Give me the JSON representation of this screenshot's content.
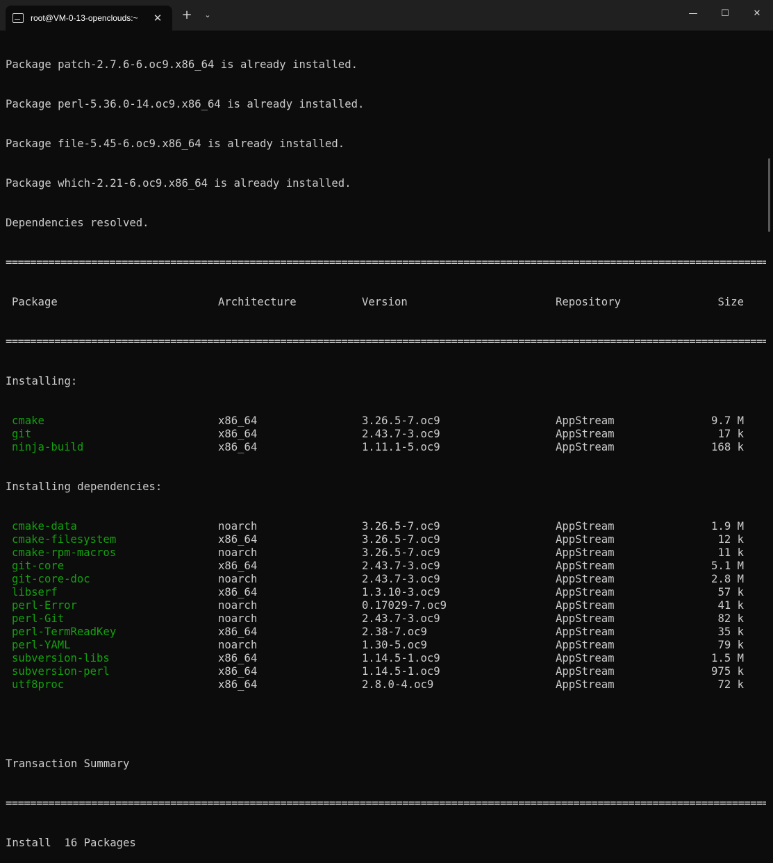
{
  "titlebar": {
    "tab_title": "root@VM-0-13-openclouds:~",
    "tab_close": "✕",
    "new_tab": "+",
    "dropdown": "⌄",
    "minimize": "—",
    "maximize": "☐",
    "close": "✕"
  },
  "output": {
    "pre_lines": [
      "Package patch-2.7.6-6.oc9.x86_64 is already installed.",
      "Package perl-5.36.0-14.oc9.x86_64 is already installed.",
      "Package file-5.45-6.oc9.x86_64 is already installed.",
      "Package which-2.21-6.oc9.x86_64 is already installed.",
      "Dependencies resolved."
    ],
    "rule": "================================================================================================================================",
    "header": {
      "package": "Package",
      "arch": "Architecture",
      "version": "Version",
      "repo": "Repository",
      "size": "Size"
    },
    "installing_label": "Installing:",
    "installing": [
      {
        "name": "cmake",
        "arch": "x86_64",
        "version": "3.26.5-7.oc9",
        "repo": "AppStream",
        "size": "9.7 M"
      },
      {
        "name": "git",
        "arch": "x86_64",
        "version": "2.43.7-3.oc9",
        "repo": "AppStream",
        "size": "17 k"
      },
      {
        "name": "ninja-build",
        "arch": "x86_64",
        "version": "1.11.1-5.oc9",
        "repo": "AppStream",
        "size": "168 k"
      }
    ],
    "deps_label": "Installing dependencies:",
    "deps": [
      {
        "name": "cmake-data",
        "arch": "noarch",
        "version": "3.26.5-7.oc9",
        "repo": "AppStream",
        "size": "1.9 M"
      },
      {
        "name": "cmake-filesystem",
        "arch": "x86_64",
        "version": "3.26.5-7.oc9",
        "repo": "AppStream",
        "size": "12 k"
      },
      {
        "name": "cmake-rpm-macros",
        "arch": "noarch",
        "version": "3.26.5-7.oc9",
        "repo": "AppStream",
        "size": "11 k"
      },
      {
        "name": "git-core",
        "arch": "x86_64",
        "version": "2.43.7-3.oc9",
        "repo": "AppStream",
        "size": "5.1 M"
      },
      {
        "name": "git-core-doc",
        "arch": "noarch",
        "version": "2.43.7-3.oc9",
        "repo": "AppStream",
        "size": "2.8 M"
      },
      {
        "name": "libserf",
        "arch": "x86_64",
        "version": "1.3.10-3.oc9",
        "repo": "AppStream",
        "size": "57 k"
      },
      {
        "name": "perl-Error",
        "arch": "noarch",
        "version": "0.17029-7.oc9",
        "repo": "AppStream",
        "size": "41 k"
      },
      {
        "name": "perl-Git",
        "arch": "noarch",
        "version": "2.43.7-3.oc9",
        "repo": "AppStream",
        "size": "82 k"
      },
      {
        "name": "perl-TermReadKey",
        "arch": "x86_64",
        "version": "2.38-7.oc9",
        "repo": "AppStream",
        "size": "35 k"
      },
      {
        "name": "perl-YAML",
        "arch": "noarch",
        "version": "1.30-5.oc9",
        "repo": "AppStream",
        "size": "79 k"
      },
      {
        "name": "subversion-libs",
        "arch": "x86_64",
        "version": "1.14.5-1.oc9",
        "repo": "AppStream",
        "size": "1.5 M"
      },
      {
        "name": "subversion-perl",
        "arch": "x86_64",
        "version": "1.14.5-1.oc9",
        "repo": "AppStream",
        "size": "975 k"
      },
      {
        "name": "utf8proc",
        "arch": "x86_64",
        "version": "2.8.0-4.oc9",
        "repo": "AppStream",
        "size": "72 k"
      }
    ],
    "summary_label": "Transaction Summary",
    "install_summary": "Install  16 Packages"
  },
  "colors": {
    "package_name": "#13a10e",
    "background": "#0c0c0c",
    "text": "#cccccc"
  }
}
